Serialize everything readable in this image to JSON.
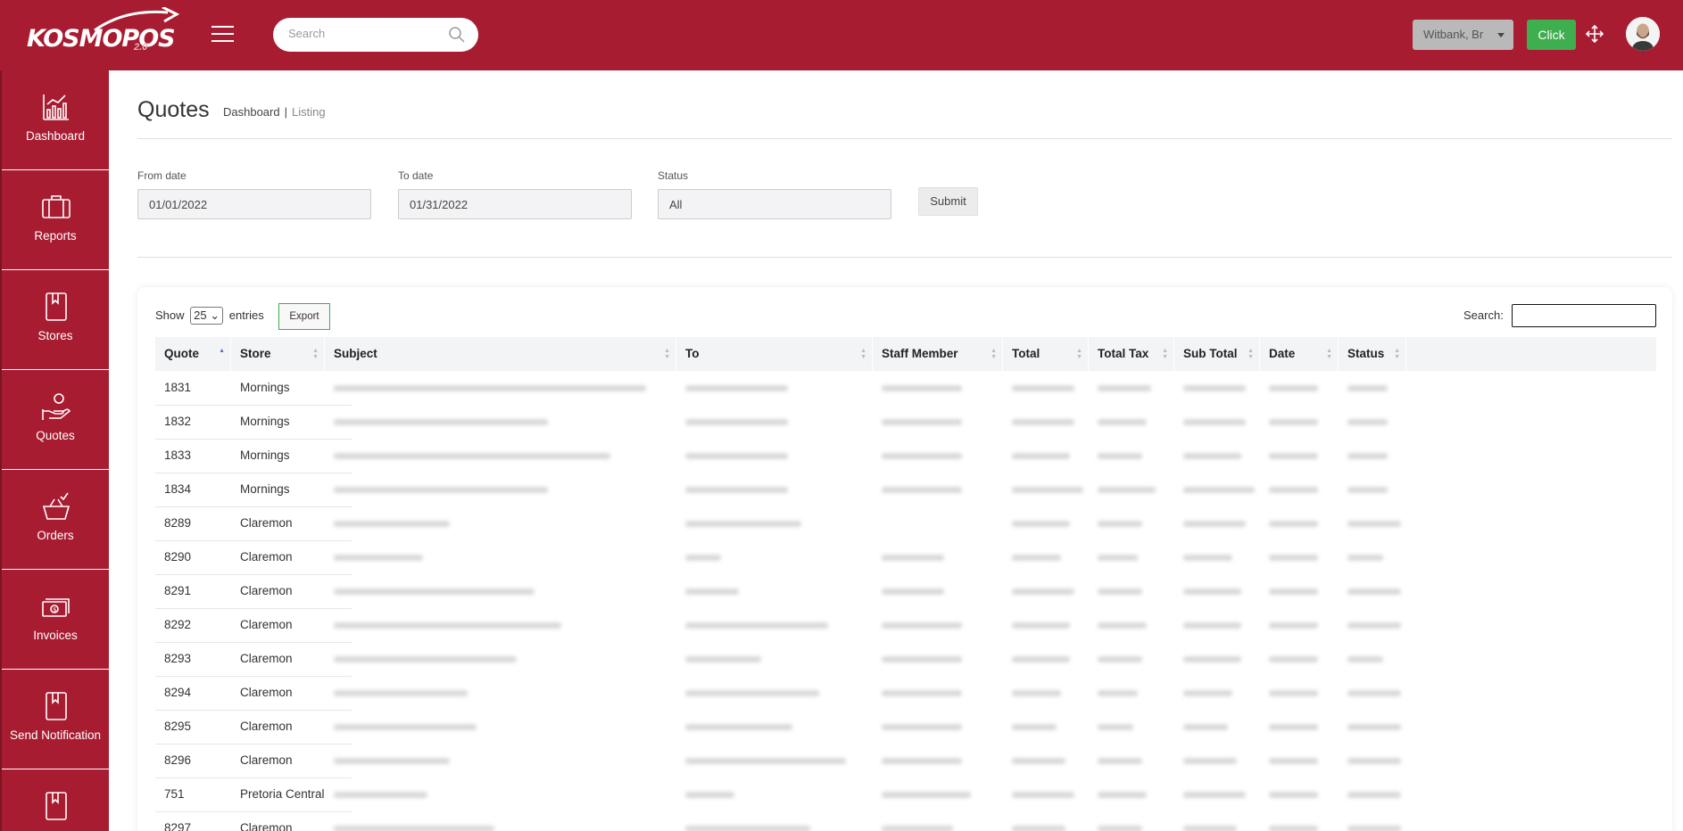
{
  "brand": {
    "name": "KOSMOPOS",
    "version": "2.0"
  },
  "header": {
    "search_placeholder": "Search",
    "branch": "Witbank, Br",
    "click_label": "Click"
  },
  "sidebar": {
    "items": [
      {
        "label": "Dashboard"
      },
      {
        "label": "Reports"
      },
      {
        "label": "Stores"
      },
      {
        "label": "Quotes"
      },
      {
        "label": "Orders"
      },
      {
        "label": "Invoices"
      },
      {
        "label": "Send Notification"
      },
      {
        "label": ""
      }
    ]
  },
  "page": {
    "title": "Quotes",
    "breadcrumb": {
      "home": "Dashboard",
      "separator": "|",
      "current": "Listing"
    }
  },
  "filters": {
    "from_label": "From date",
    "from_value": "01/01/2022",
    "to_label": "To date",
    "to_value": "01/31/2022",
    "status_label": "Status",
    "status_value": "All",
    "submit_label": "Submit"
  },
  "table": {
    "show_label": "Show",
    "entries_value": "25",
    "entries_label": "entries",
    "export_label": "Export",
    "search_label": "Search:",
    "columns": [
      "Quote",
      "Store",
      "Subject",
      "To",
      "Staff Member",
      "Total",
      "Total Tax",
      "Sub Total",
      "Date",
      "Status"
    ],
    "rows": [
      {
        "quote": "1831",
        "store": "Mornings"
      },
      {
        "quote": "1832",
        "store": "Mornings"
      },
      {
        "quote": "1833",
        "store": "Mornings"
      },
      {
        "quote": "1834",
        "store": "Mornings"
      },
      {
        "quote": "8289",
        "store": "Claremon"
      },
      {
        "quote": "8290",
        "store": "Claremon"
      },
      {
        "quote": "8291",
        "store": "Claremon"
      },
      {
        "quote": "8292",
        "store": "Claremon"
      },
      {
        "quote": "8293",
        "store": "Claremon"
      },
      {
        "quote": "8294",
        "store": "Claremon"
      },
      {
        "quote": "8295",
        "store": "Claremon"
      },
      {
        "quote": "8296",
        "store": "Claremon"
      },
      {
        "quote": "751",
        "store": "Pretoria Central"
      },
      {
        "quote": "8297",
        "store": "Claremon"
      }
    ]
  },
  "colors": {
    "brand_red": "#a81c31",
    "accent_green": "#3fae4f"
  }
}
